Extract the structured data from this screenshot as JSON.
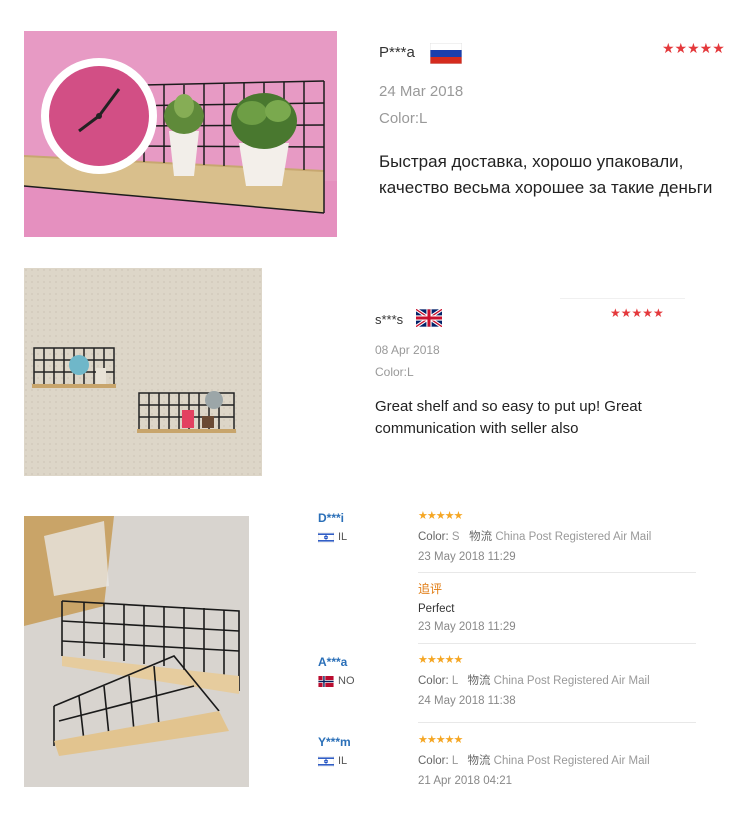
{
  "review1": {
    "user": "P***a",
    "flag": "russia-flag",
    "stars": "★★★★★",
    "rating": 5,
    "date": "24 Mar 2018",
    "color": "Color:L",
    "text": "Быстрая доставка, хорошо упаковали, качество весьма хорошее за такие деньги"
  },
  "review2": {
    "user": "s***s",
    "flag": "uk-flag",
    "stars": "★★★★★",
    "rating": 5,
    "date": "08 Apr 2018",
    "color": "Color:L",
    "text": "Great shelf and so easy to put up! Great communication with seller also"
  },
  "review_list": [
    {
      "user": "D***i",
      "country": "IL",
      "stars": "★★★★★",
      "rating": 5,
      "color_label": "Color:",
      "color_value": "S",
      "shipping_label": "物流",
      "shipping_value": "China Post Registered Air Mail",
      "date": "23 May 2018 11:29"
    },
    {
      "user": "A***a",
      "country": "NO",
      "stars": "★★★★★",
      "rating": 5,
      "color_label": "Color:",
      "color_value": "L",
      "shipping_label": "物流",
      "shipping_value": "China Post Registered Air Mail",
      "date": "24 May 2018 11:38"
    },
    {
      "user": "Y***m",
      "country": "IL",
      "stars": "★★★★★",
      "rating": 5,
      "color_label": "Color:",
      "color_value": "L",
      "shipping_label": "物流",
      "shipping_value": "China Post Registered Air Mail",
      "date": "21 Apr 2018 04:21"
    }
  ],
  "followup": {
    "label": "追评",
    "text": "Perfect",
    "date": "23 May 2018 11:29"
  },
  "colors": {
    "star_red": "#e4393c",
    "star_orange": "#f5a623",
    "username_blue": "#2a6fb8",
    "followup_orange": "#e07a10"
  }
}
